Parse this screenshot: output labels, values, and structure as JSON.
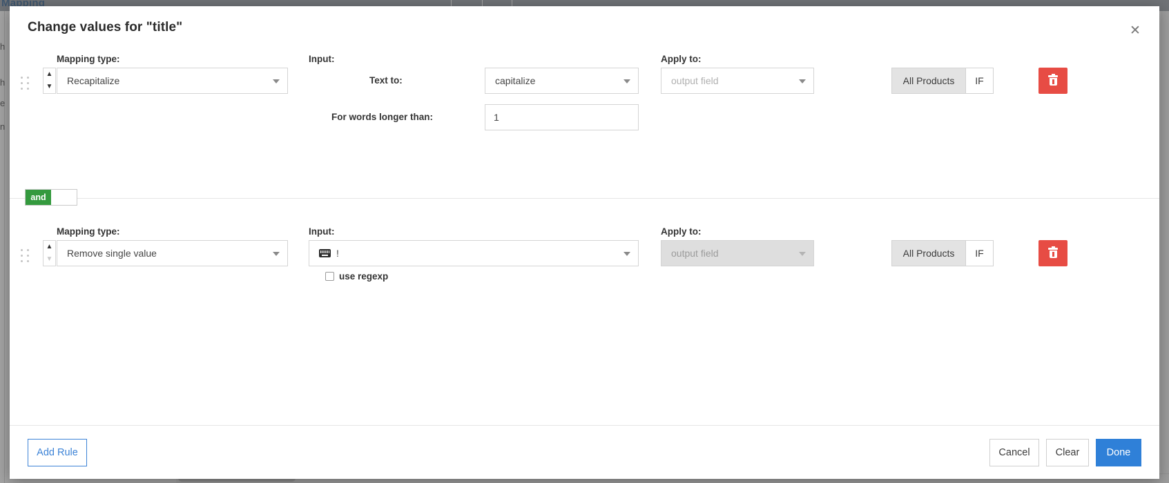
{
  "background": {
    "tab_label": "Mapping",
    "rows": [
      {
        "text": "h"
      },
      {
        "text": "h"
      },
      {
        "text": "e"
      },
      {
        "text": "n"
      }
    ]
  },
  "modal": {
    "title": "Change values for \"title\"",
    "close_icon": "close-icon",
    "rules": [
      {
        "drag_icon": "drag-handle-icon",
        "reorder_up_icon": "chevron-up-icon",
        "reorder_down_icon": "chevron-down-icon",
        "mapping_type_label": "Mapping type:",
        "mapping_type_value": "Recapitalize",
        "input_label": "Input:",
        "fields": [
          {
            "label": "Text to:",
            "value": "capitalize",
            "kind": "select"
          },
          {
            "label": "For words longer than:",
            "value": "1",
            "kind": "text"
          }
        ],
        "apply_to_label": "Apply to:",
        "apply_to_placeholder": "output field",
        "apply_to_disabled": false,
        "scope_all_label": "All Products",
        "scope_if_label": "IF",
        "scope_active": "All Products",
        "delete_icon": "trash-icon"
      },
      {
        "drag_icon": "drag-handle-icon",
        "reorder_up_icon": "chevron-up-icon",
        "reorder_down_icon": "chevron-down-icon",
        "mapping_type_label": "Mapping type:",
        "mapping_type_value": "Remove single value",
        "input_label": "Input:",
        "input_value": "!",
        "input_icon": "keyboard-icon",
        "regexp_label": "use regexp",
        "regexp_checked": false,
        "apply_to_label": "Apply to:",
        "apply_to_placeholder": "output field",
        "apply_to_disabled": true,
        "scope_all_label": "All Products",
        "scope_if_label": "IF",
        "scope_active": "All Products",
        "delete_icon": "trash-icon"
      }
    ],
    "separator": {
      "and_label": "and",
      "or_label": "",
      "selected": "and",
      "accent_color": "#349a3e"
    },
    "footer": {
      "add_rule_label": "Add Rule",
      "cancel_label": "Cancel",
      "clear_label": "Clear",
      "done_label": "Done",
      "primary_color": "#2f80d8",
      "danger_color": "#e74c44"
    }
  }
}
